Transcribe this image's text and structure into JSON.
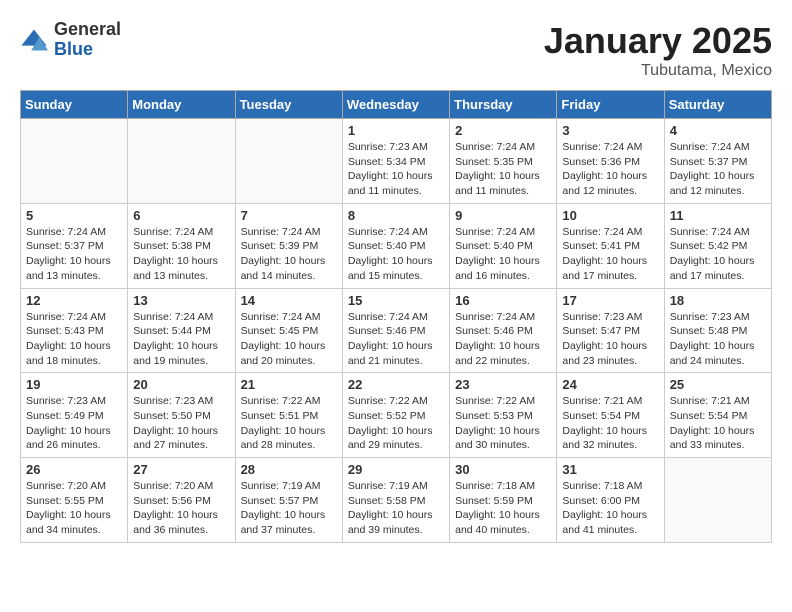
{
  "header": {
    "logo": {
      "general": "General",
      "blue": "Blue"
    },
    "title": "January 2025",
    "subtitle": "Tubutama, Mexico"
  },
  "weekdays": [
    "Sunday",
    "Monday",
    "Tuesday",
    "Wednesday",
    "Thursday",
    "Friday",
    "Saturday"
  ],
  "weeks": [
    [
      {
        "day": "",
        "info": ""
      },
      {
        "day": "",
        "info": ""
      },
      {
        "day": "",
        "info": ""
      },
      {
        "day": "1",
        "info": "Sunrise: 7:23 AM\nSunset: 5:34 PM\nDaylight: 10 hours and 11 minutes."
      },
      {
        "day": "2",
        "info": "Sunrise: 7:24 AM\nSunset: 5:35 PM\nDaylight: 10 hours and 11 minutes."
      },
      {
        "day": "3",
        "info": "Sunrise: 7:24 AM\nSunset: 5:36 PM\nDaylight: 10 hours and 12 minutes."
      },
      {
        "day": "4",
        "info": "Sunrise: 7:24 AM\nSunset: 5:37 PM\nDaylight: 10 hours and 12 minutes."
      }
    ],
    [
      {
        "day": "5",
        "info": "Sunrise: 7:24 AM\nSunset: 5:37 PM\nDaylight: 10 hours and 13 minutes."
      },
      {
        "day": "6",
        "info": "Sunrise: 7:24 AM\nSunset: 5:38 PM\nDaylight: 10 hours and 13 minutes."
      },
      {
        "day": "7",
        "info": "Sunrise: 7:24 AM\nSunset: 5:39 PM\nDaylight: 10 hours and 14 minutes."
      },
      {
        "day": "8",
        "info": "Sunrise: 7:24 AM\nSunset: 5:40 PM\nDaylight: 10 hours and 15 minutes."
      },
      {
        "day": "9",
        "info": "Sunrise: 7:24 AM\nSunset: 5:40 PM\nDaylight: 10 hours and 16 minutes."
      },
      {
        "day": "10",
        "info": "Sunrise: 7:24 AM\nSunset: 5:41 PM\nDaylight: 10 hours and 17 minutes."
      },
      {
        "day": "11",
        "info": "Sunrise: 7:24 AM\nSunset: 5:42 PM\nDaylight: 10 hours and 17 minutes."
      }
    ],
    [
      {
        "day": "12",
        "info": "Sunrise: 7:24 AM\nSunset: 5:43 PM\nDaylight: 10 hours and 18 minutes."
      },
      {
        "day": "13",
        "info": "Sunrise: 7:24 AM\nSunset: 5:44 PM\nDaylight: 10 hours and 19 minutes."
      },
      {
        "day": "14",
        "info": "Sunrise: 7:24 AM\nSunset: 5:45 PM\nDaylight: 10 hours and 20 minutes."
      },
      {
        "day": "15",
        "info": "Sunrise: 7:24 AM\nSunset: 5:46 PM\nDaylight: 10 hours and 21 minutes."
      },
      {
        "day": "16",
        "info": "Sunrise: 7:24 AM\nSunset: 5:46 PM\nDaylight: 10 hours and 22 minutes."
      },
      {
        "day": "17",
        "info": "Sunrise: 7:23 AM\nSunset: 5:47 PM\nDaylight: 10 hours and 23 minutes."
      },
      {
        "day": "18",
        "info": "Sunrise: 7:23 AM\nSunset: 5:48 PM\nDaylight: 10 hours and 24 minutes."
      }
    ],
    [
      {
        "day": "19",
        "info": "Sunrise: 7:23 AM\nSunset: 5:49 PM\nDaylight: 10 hours and 26 minutes."
      },
      {
        "day": "20",
        "info": "Sunrise: 7:23 AM\nSunset: 5:50 PM\nDaylight: 10 hours and 27 minutes."
      },
      {
        "day": "21",
        "info": "Sunrise: 7:22 AM\nSunset: 5:51 PM\nDaylight: 10 hours and 28 minutes."
      },
      {
        "day": "22",
        "info": "Sunrise: 7:22 AM\nSunset: 5:52 PM\nDaylight: 10 hours and 29 minutes."
      },
      {
        "day": "23",
        "info": "Sunrise: 7:22 AM\nSunset: 5:53 PM\nDaylight: 10 hours and 30 minutes."
      },
      {
        "day": "24",
        "info": "Sunrise: 7:21 AM\nSunset: 5:54 PM\nDaylight: 10 hours and 32 minutes."
      },
      {
        "day": "25",
        "info": "Sunrise: 7:21 AM\nSunset: 5:54 PM\nDaylight: 10 hours and 33 minutes."
      }
    ],
    [
      {
        "day": "26",
        "info": "Sunrise: 7:20 AM\nSunset: 5:55 PM\nDaylight: 10 hours and 34 minutes."
      },
      {
        "day": "27",
        "info": "Sunrise: 7:20 AM\nSunset: 5:56 PM\nDaylight: 10 hours and 36 minutes."
      },
      {
        "day": "28",
        "info": "Sunrise: 7:19 AM\nSunset: 5:57 PM\nDaylight: 10 hours and 37 minutes."
      },
      {
        "day": "29",
        "info": "Sunrise: 7:19 AM\nSunset: 5:58 PM\nDaylight: 10 hours and 39 minutes."
      },
      {
        "day": "30",
        "info": "Sunrise: 7:18 AM\nSunset: 5:59 PM\nDaylight: 10 hours and 40 minutes."
      },
      {
        "day": "31",
        "info": "Sunrise: 7:18 AM\nSunset: 6:00 PM\nDaylight: 10 hours and 41 minutes."
      },
      {
        "day": "",
        "info": ""
      }
    ]
  ]
}
